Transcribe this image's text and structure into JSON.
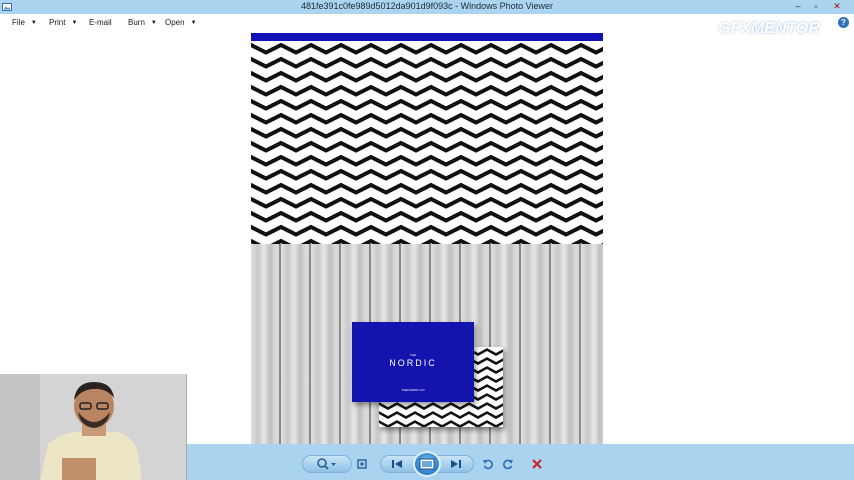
{
  "window": {
    "title": "481fe391c0fe989d5012da901d9f093c - Windows Photo Viewer",
    "icon": "photo-viewer-icon",
    "controls": {
      "minimize": "–",
      "maximize": "▫",
      "close": "✕"
    }
  },
  "menu": {
    "items": [
      {
        "label": "File",
        "has_dropdown": true
      },
      {
        "label": "Print",
        "has_dropdown": true
      },
      {
        "label": "E-mail",
        "has_dropdown": false
      },
      {
        "label": "Burn",
        "has_dropdown": true
      },
      {
        "label": "Open",
        "has_dropdown": true
      }
    ],
    "help_label": "?"
  },
  "watermark": {
    "part1": "GFX",
    "part2": "MENTOR"
  },
  "image": {
    "card": {
      "small_top": "THE",
      "brand": "NORDIC",
      "small_bottom": "THENORDIC.CO"
    },
    "colors": {
      "card_blue": "#1313ad",
      "strip_blue": "#1212b8"
    }
  },
  "toolbar": {
    "buttons": [
      {
        "name": "zoom",
        "icon": "magnifier-icon"
      },
      {
        "name": "actual-size",
        "icon": "fit-window-icon"
      },
      {
        "name": "previous",
        "icon": "previous-icon"
      },
      {
        "name": "slideshow",
        "icon": "slideshow-icon"
      },
      {
        "name": "next",
        "icon": "next-icon"
      },
      {
        "name": "rotate-counterclockwise",
        "icon": "rotate-left-icon"
      },
      {
        "name": "rotate-clockwise",
        "icon": "rotate-right-icon"
      },
      {
        "name": "delete",
        "icon": "delete-icon"
      }
    ],
    "colors": {
      "bar": "#a9d3ee",
      "delete": "#d0202a"
    }
  }
}
